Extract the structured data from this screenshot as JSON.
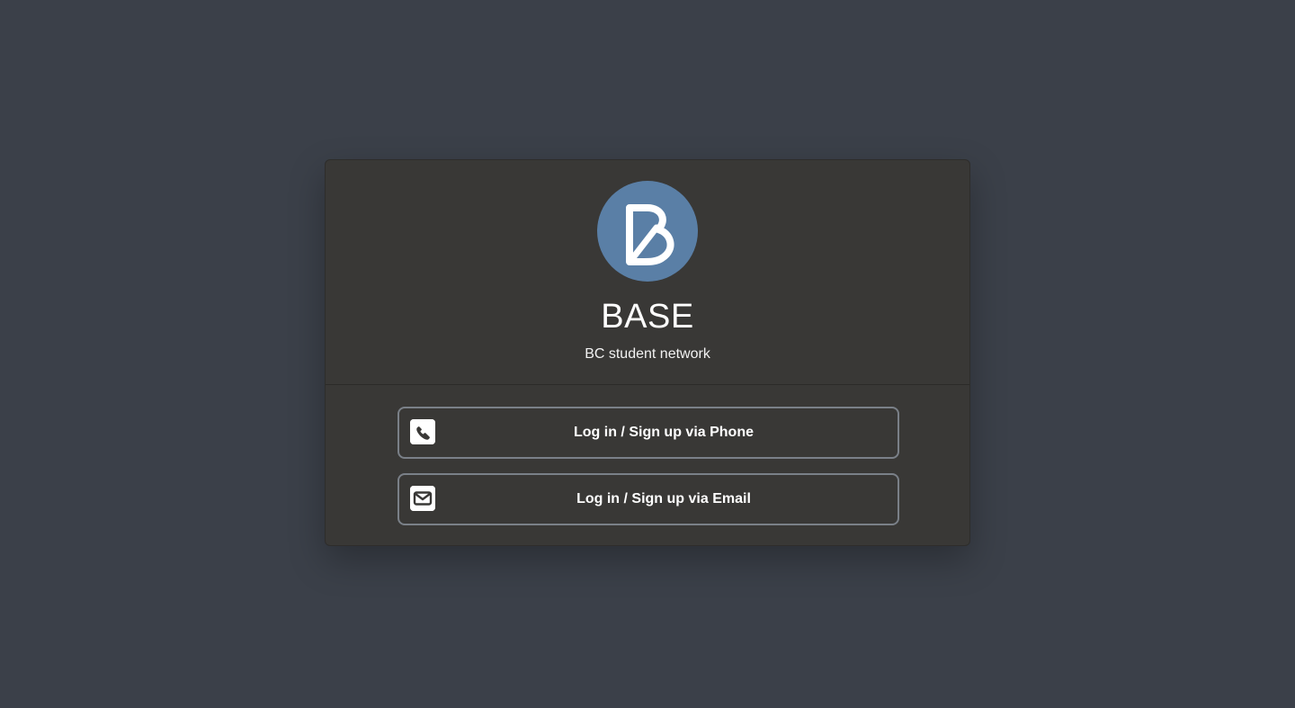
{
  "app": {
    "title": "BASE",
    "subtitle": "BC student network",
    "logo_icon": "base-b-logo",
    "logo_color": "#5a7fa6"
  },
  "auth": {
    "phone_button": {
      "label": "Log in / Sign up via Phone",
      "icon": "phone-square-icon"
    },
    "email_button": {
      "label": "Log in / Sign up via Email",
      "icon": "envelope-square-icon"
    }
  },
  "colors": {
    "background": "#3b4049",
    "card": "#393836",
    "button_border": "#7a8088",
    "text": "#ffffff"
  }
}
